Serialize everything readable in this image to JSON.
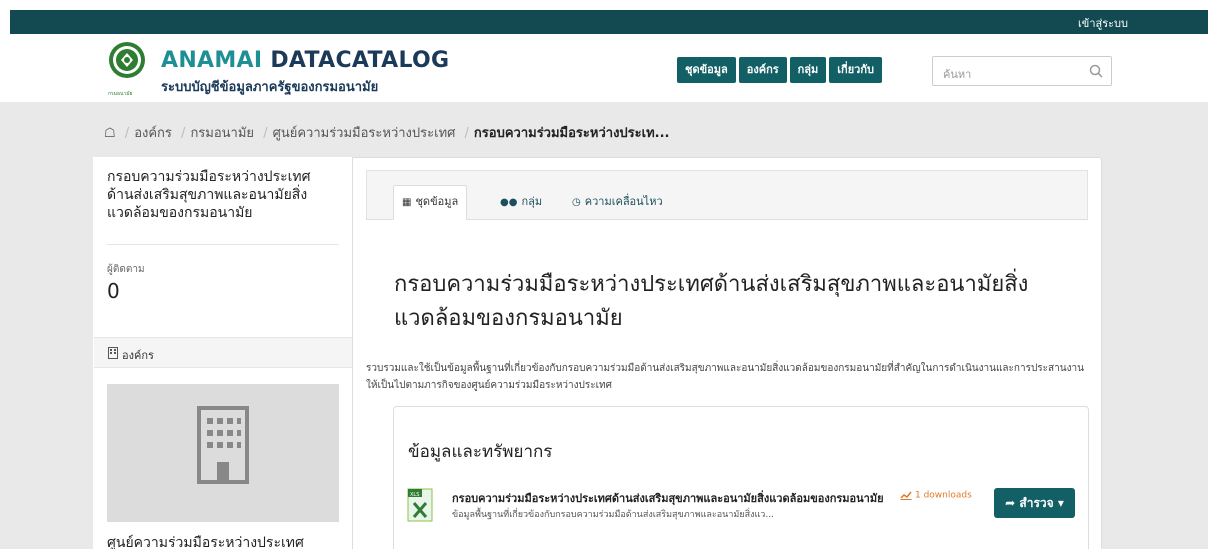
{
  "topbar": {
    "login": "เข้าสู่ระบบ"
  },
  "logo": {
    "title_main": "ANAMAI ",
    "title_bold": "DATACATALOG",
    "subtitle": "ระบบบัญชีข้อมูลภาครัฐของกรมอนามัย",
    "caption": "กรมอนามัย"
  },
  "nav": {
    "items": [
      {
        "label": "ชุดข้อมูล"
      },
      {
        "label": "องค์กร"
      },
      {
        "label": "กลุ่ม"
      },
      {
        "label": "เกี่ยวกับ"
      }
    ]
  },
  "search": {
    "placeholder": "ค้นหา"
  },
  "breadcrumb": {
    "items": [
      "องค์กร",
      "กรมอนามัย",
      "ศูนย์ความร่วมมือระหว่างประเทศ"
    ],
    "active": "กรอบความร่วมมือระหว่างประเท..."
  },
  "sidebar": {
    "title": "กรอบความร่วมมือระหว่างประเทศด้านส่งเสริมสุขภาพและอนามัยสิ่งแวดล้อมของกรมอนามัย",
    "followers_label": "ผู้ติดตาม",
    "followers_count": "0",
    "org_heading": "องค์กร",
    "org_name": "ศูนย์ความร่วมมือระหว่างประเทศ"
  },
  "tabs": [
    {
      "label": "ชุดข้อมูล",
      "icon": "sitemap-icon",
      "active": true
    },
    {
      "label": "กลุ่ม",
      "icon": "users-icon",
      "active": false
    },
    {
      "label": "ความเคลื่อนไหว",
      "icon": "clock-icon",
      "active": false
    }
  ],
  "dataset": {
    "title": "กรอบความร่วมมือระหว่างประเทศด้านส่งเสริมสุขภาพและอนามัยสิ่งแวดล้อมของกรมอนามัย",
    "description": "รวบรวมและใช้เป็นข้อมูลพื้นฐานที่เกี่ยวข้องกับกรอบความร่วมมือด้านส่งเสริมสุขภาพและอนามัยสิ่งแวดล้อมของกรมอนามัยที่สำคัญในการดำเนินงานและการประสานงานให้เป็นไปตามภารกิจของศูนย์ความร่วมมือระหว่างประเทศ"
  },
  "resources": {
    "heading": "ข้อมูลและทรัพยากร",
    "items": [
      {
        "name": "กรอบความร่วมมือระหว่างประเทศด้านส่งเสริมสุขภาพและอนามัยสิ่งแวดล้อมของกรมอนามัย",
        "desc": "ข้อมูลพื้นฐานที่เกี่ยวข้องกับกรอบความร่วมมือด้านส่งเสริมสุขภาพและอนามัยสิ่งแว...",
        "downloads": "1 downloads",
        "format": "XLS",
        "explore_label": "สำรวจ"
      }
    ]
  },
  "colors": {
    "primary": "#135f66",
    "accent": "#1e8f95",
    "topbar": "#134a52",
    "download": "#e07a2a"
  }
}
